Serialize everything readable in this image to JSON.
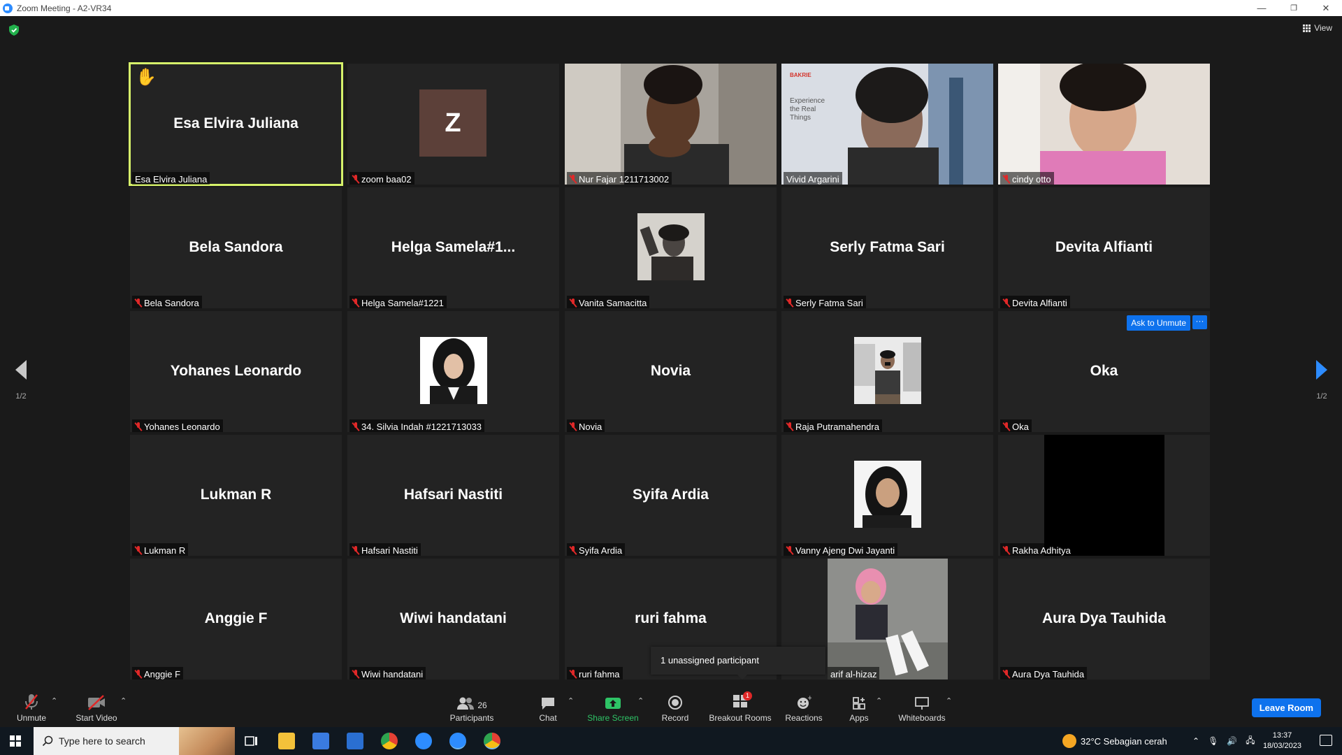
{
  "window": {
    "title": "Zoom Meeting - A2-VR34",
    "minimize": "—",
    "restore": "❐",
    "close": "✕"
  },
  "topbar": {
    "view_label": "View"
  },
  "tiles": [
    {
      "big_name": "Esa Elvira Juliana",
      "label": "Esa Elvira Juliana",
      "muted": false,
      "hand": "✋"
    },
    {
      "avatar_letter": "Z",
      "label": "zoom baa02",
      "muted": true
    },
    {
      "label": "Nur Fajar 1211713002",
      "muted": true
    },
    {
      "label": "Vivid Argarini",
      "muted": false,
      "banner_brand": "BAKRIE",
      "banner_text": "Experience the Real Things"
    },
    {
      "label": "cindy otto",
      "muted": true
    },
    {
      "big_name": "Bela Sandora",
      "label": "Bela Sandora",
      "muted": true
    },
    {
      "big_name": "Helga  Samela#1...",
      "label": "Helga Samela#1221",
      "muted": true
    },
    {
      "label": "Vanita Samacitta",
      "muted": true
    },
    {
      "big_name": "Serly Fatma Sari",
      "label": "Serly Fatma Sari",
      "muted": true
    },
    {
      "big_name": "Devita Alfianti",
      "label": "Devita Alfianti",
      "muted": true
    },
    {
      "big_name": "Yohanes Leonardo",
      "label": "Yohanes Leonardo",
      "muted": true
    },
    {
      "label": "34. Silvia Indah #1221713033",
      "muted": true
    },
    {
      "big_name": "Novia",
      "label": "Novia",
      "muted": true
    },
    {
      "label": "Raja Putramahendra",
      "muted": true
    },
    {
      "big_name": "Oka",
      "label": "Oka",
      "muted": true,
      "ask_unmute": "Ask to Unmute",
      "more": "···"
    },
    {
      "big_name": "Lukman R",
      "label": "Lukman R",
      "muted": true
    },
    {
      "big_name": "Hafsari Nastiti",
      "label": "Hafsari Nastiti",
      "muted": true
    },
    {
      "big_name": "Syifa Ardia",
      "label": "Syifa Ardia",
      "muted": true
    },
    {
      "label": "Vanny Ajeng Dwi Jayanti",
      "muted": true
    },
    {
      "label": "Rakha Adhitya",
      "muted": true
    },
    {
      "big_name": "Anggie F",
      "label": "Anggie F",
      "muted": true
    },
    {
      "big_name": "Wiwi handatani",
      "label": "Wiwi handatani",
      "muted": true
    },
    {
      "big_name": "ruri fahma",
      "label": "ruri fahma",
      "muted": true
    },
    {
      "label": "arif al-hizaz",
      "muted": false
    },
    {
      "big_name": "Aura Dya Tauhida",
      "label": "Aura Dya Tauhida",
      "muted": true
    }
  ],
  "pager": {
    "left": "1/2",
    "right": "1/2"
  },
  "popup": {
    "text": "1 unassigned participant"
  },
  "toolbar": {
    "unmute": "Unmute",
    "start_video": "Start Video",
    "participants": "Participants",
    "participants_count": "26",
    "chat": "Chat",
    "share_screen": "Share Screen",
    "record": "Record",
    "breakout_rooms": "Breakout Rooms",
    "breakout_badge": "1",
    "reactions": "Reactions",
    "apps": "Apps",
    "whiteboards": "Whiteboards",
    "leave": "Leave Room"
  },
  "taskbar": {
    "search_placeholder": "Type here to search",
    "weather": "32°C  Sebagian cerah",
    "time": "13:37",
    "date": "18/03/2023"
  },
  "colors": {
    "accent": "#0e72ed",
    "active_speaker": "#d6f26a",
    "muted": "#e02828",
    "share_green": "#2ec466"
  }
}
